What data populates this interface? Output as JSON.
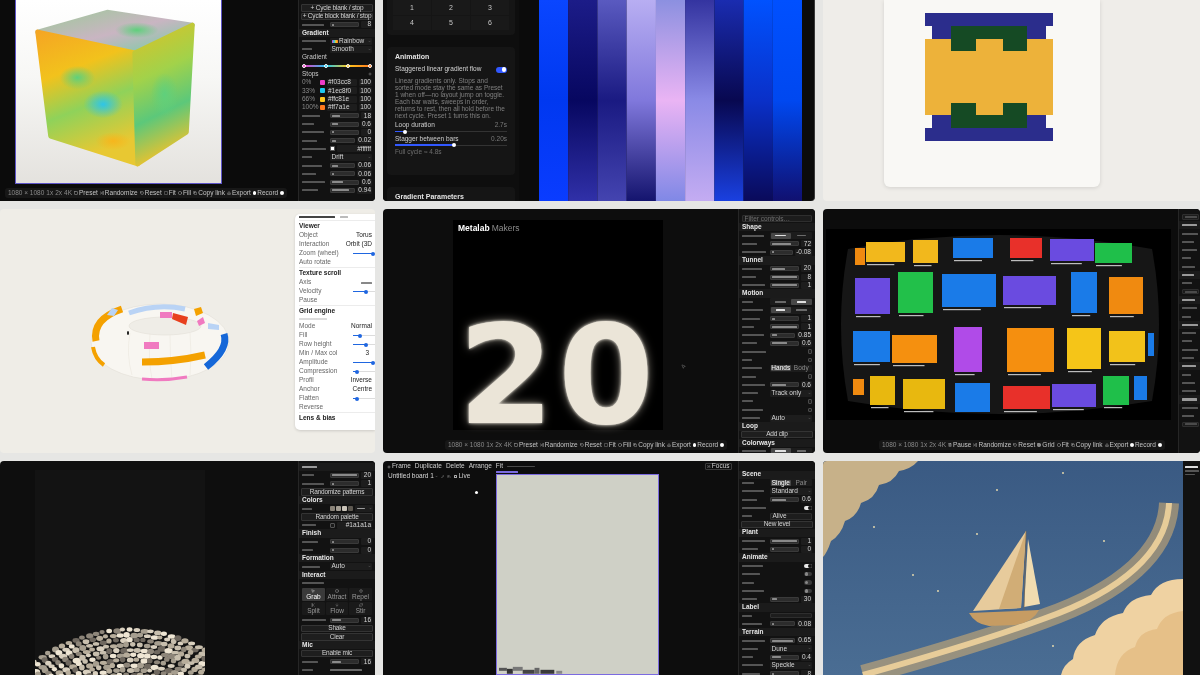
{
  "cube_editor": {
    "controls": [
      {
        "kind": "button",
        "label": "+ Cycle blank / stop"
      },
      {
        "kind": "button",
        "label": "+ Cycle block blank / stop"
      },
      {
        "kind": "slider",
        "level": 0.05,
        "value": "8"
      },
      {
        "kind": "header",
        "label": "Gradient"
      },
      {
        "kind": "palette",
        "value": "Rainbow"
      },
      {
        "kind": "select",
        "value": "Smooth"
      },
      {
        "kind": "gradient",
        "label": "Gradient"
      },
      {
        "kind": "subheader",
        "label": "Stops"
      },
      {
        "kind": "stop",
        "label": "0%",
        "color": "#f03cc8",
        "value": "#f03cc8",
        "amount": "100"
      },
      {
        "kind": "stop",
        "label": "33%",
        "color": "#1ec8f0",
        "value": "#1ec8f0",
        "amount": "100"
      },
      {
        "kind": "stop",
        "label": "66%",
        "color": "#ffc81e",
        "value": "#ffc81e",
        "amount": "100"
      },
      {
        "kind": "stop",
        "label": "100%",
        "color": "#ff7a1e",
        "value": "#ff7a1e",
        "amount": "100"
      },
      {
        "kind": "slider",
        "level": 0.3,
        "value": "18"
      },
      {
        "kind": "slider",
        "level": 0.25,
        "value": "0.6"
      },
      {
        "kind": "slider",
        "level": 0,
        "value": "0"
      },
      {
        "kind": "slider",
        "level": 0.18,
        "value": "0.02"
      },
      {
        "kind": "swatch",
        "color": "#ffffff",
        "value": "#ffffff"
      },
      {
        "kind": "select",
        "value": "Drift"
      },
      {
        "kind": "slider",
        "level": 0.3,
        "value": "0.06"
      },
      {
        "kind": "slider",
        "level": 0.04,
        "value": "0.06"
      },
      {
        "kind": "slider",
        "level": 0.45,
        "value": "0.6"
      },
      {
        "kind": "slider",
        "level": 0.78,
        "value": "0.94"
      }
    ],
    "toolbar": [
      {
        "kind": "size",
        "label": "1080 × 1080"
      },
      {
        "kind": "chip",
        "label": "1x"
      },
      {
        "kind": "chip",
        "label": "2x"
      },
      {
        "kind": "chip",
        "label": "4K"
      },
      {
        "kind": "preset",
        "label": "Preset"
      },
      {
        "kind": "randomize",
        "label": "Randomize"
      },
      {
        "kind": "reset",
        "label": "Reset"
      },
      {
        "kind": "fit",
        "label": "Fit"
      },
      {
        "kind": "fill",
        "label": "Fill"
      },
      {
        "kind": "copy",
        "label": "Copy link"
      },
      {
        "kind": "export",
        "label": "Export"
      },
      {
        "kind": "record",
        "label": "Record"
      },
      {
        "kind": "dot"
      }
    ]
  },
  "bars_editor": {
    "keypad": [
      "1",
      "2",
      "3",
      "4",
      "5",
      "6"
    ],
    "animation": {
      "title": "Animation",
      "toggle": {
        "label": "Staggered linear gradient flow",
        "on": true
      },
      "description": "Linear gradients only. Stops and sorted mode stay the same as Preset 1 when off—no layout jump on toggle. Each bar waits, sweeps in order, returns to rest, then all hold before the next cycle. Preset 1 turns this on.",
      "sliders": [
        {
          "label": "Loop duration",
          "value": "2.7s",
          "level": 0.09
        },
        {
          "label": "Stagger between bars",
          "value": "0.20s",
          "level": 0.53
        }
      ],
      "note": "Full cycle ≈ 4.8s"
    },
    "next_card": {
      "title": "Gradient Parameters"
    }
  },
  "torus_viewer": {
    "panel": {
      "controls": [
        {
          "kind": "header",
          "label": "Viewer"
        },
        {
          "kind": "select",
          "label": "Object",
          "value": "Torus"
        },
        {
          "kind": "select",
          "label": "Interaction",
          "value": "Orbit (3D"
        },
        {
          "kind": "slider",
          "label": "Zoom (wheel)",
          "level": 1
        },
        {
          "kind": "label",
          "label": "Auto rotate"
        },
        {
          "kind": "header",
          "label": "Texture scroll"
        },
        {
          "kind": "select",
          "label": "Axis"
        },
        {
          "kind": "slider",
          "label": "Velocity",
          "level": 0.6
        },
        {
          "kind": "label",
          "label": "Pause"
        },
        {
          "kind": "header",
          "label": "Grid engine"
        },
        {
          "kind": "note"
        },
        {
          "kind": "select",
          "label": "Mode",
          "value": "Normal"
        },
        {
          "kind": "slider",
          "label": "Fill",
          "level": 0.25
        },
        {
          "kind": "slider",
          "label": "Row height",
          "level": 0.6
        },
        {
          "kind": "text",
          "label": "Min / Max col",
          "value": "3"
        },
        {
          "kind": "slider",
          "label": "Amplitude",
          "level": 1
        },
        {
          "kind": "slider",
          "label": "Compression",
          "level": 0.1
        },
        {
          "kind": "select",
          "label": "Profil",
          "value": "Inverse"
        },
        {
          "kind": "select",
          "label": "Anchor",
          "value": "Centre"
        },
        {
          "kind": "slider",
          "label": "Flatten",
          "level": 0.1
        },
        {
          "kind": "label",
          "label": "Reverse"
        },
        {
          "kind": "header",
          "label": "Lens & bias"
        }
      ]
    }
  },
  "poster_editor": {
    "poster": {
      "title": "Metalab",
      "subtitle": "Makers",
      "numeral": "20"
    },
    "toolbar": [
      {
        "kind": "size",
        "label": "1080 × 1080"
      },
      {
        "kind": "chip",
        "label": "1x"
      },
      {
        "kind": "chip",
        "label": "2x"
      },
      {
        "kind": "chip",
        "label": "4K"
      },
      {
        "kind": "preset",
        "label": "Preset"
      },
      {
        "kind": "randomize",
        "label": "Randomize"
      },
      {
        "kind": "reset",
        "label": "Reset"
      },
      {
        "kind": "fit",
        "label": "Fit"
      },
      {
        "kind": "fill",
        "label": "Fill"
      },
      {
        "kind": "copy",
        "label": "Copy link"
      },
      {
        "kind": "export",
        "label": "Export"
      },
      {
        "kind": "record",
        "label": "Record"
      },
      {
        "kind": "dot"
      }
    ],
    "controls": [
      {
        "kind": "search",
        "placeholder": "Filter controls…"
      },
      {
        "kind": "header",
        "label": "Shape"
      },
      {
        "kind": "segmented",
        "options": [
          {
            "selected": true
          },
          {
            "selected": false
          }
        ]
      },
      {
        "kind": "slider",
        "level": 0.75,
        "value": "72"
      },
      {
        "kind": "slider",
        "level": 0.12,
        "value": "-0.08"
      },
      {
        "kind": "header",
        "label": "Tunnel"
      },
      {
        "kind": "slider",
        "level": 0.5,
        "value": "20"
      },
      {
        "kind": "slider",
        "level": 1,
        "value": "8"
      },
      {
        "kind": "slider",
        "level": 1,
        "value": "1"
      },
      {
        "kind": "header",
        "label": "Motion"
      },
      {
        "kind": "segmented",
        "options": [
          {
            "selected": false
          },
          {
            "selected": true
          }
        ]
      },
      {
        "kind": "segmented",
        "options": [
          {
            "selected": true
          },
          {
            "selected": false
          }
        ]
      },
      {
        "kind": "slider",
        "level": 0.12,
        "value": "1"
      },
      {
        "kind": "slider",
        "level": 1,
        "value": "1"
      },
      {
        "kind": "slider",
        "level": 0.25,
        "value": "0.85"
      },
      {
        "kind": "slider",
        "level": 0.6,
        "value": "0.6"
      },
      {
        "kind": "check",
        "checked": false
      },
      {
        "kind": "check",
        "checked": false
      },
      {
        "kind": "segmented",
        "options": [
          {
            "label": "Hands",
            "selected": true
          },
          {
            "label": "Body",
            "selected": false
          }
        ]
      },
      {
        "kind": "check",
        "checked": false
      },
      {
        "kind": "slider",
        "level": 0.55,
        "value": "0.6"
      },
      {
        "kind": "select",
        "value": "Track only"
      },
      {
        "kind": "check",
        "checked": false
      },
      {
        "kind": "check",
        "checked": false
      },
      {
        "kind": "select",
        "value": "Auto"
      },
      {
        "kind": "header",
        "label": "Loop"
      },
      {
        "kind": "button",
        "label": "Add clip"
      },
      {
        "kind": "header",
        "label": "Colorways"
      },
      {
        "kind": "segmented",
        "options": [
          {
            "selected": true
          },
          {
            "selected": false
          }
        ]
      }
    ]
  },
  "gallery_editor": {
    "toolbar": [
      {
        "kind": "size",
        "label": "1080 × 1080"
      },
      {
        "kind": "chip",
        "label": "1x"
      },
      {
        "kind": "chip",
        "label": "2x"
      },
      {
        "kind": "chip",
        "label": "4K"
      },
      {
        "kind": "pause",
        "label": "Pause"
      },
      {
        "kind": "randomize",
        "label": "Randomize"
      },
      {
        "kind": "reset",
        "label": "Reset"
      },
      {
        "kind": "grid",
        "label": "Grid"
      },
      {
        "kind": "fill",
        "label": "Fit"
      },
      {
        "kind": "copy",
        "label": "Copy link"
      },
      {
        "kind": "export",
        "label": "Export"
      },
      {
        "kind": "record",
        "label": "Record"
      },
      {
        "kind": "dot"
      }
    ],
    "controls": [
      {
        "kind": "search"
      },
      {
        "kind": "header"
      },
      {
        "kind": "label"
      },
      {
        "kind": "label"
      },
      {
        "kind": "label"
      },
      {
        "kind": "label"
      },
      {
        "kind": "label"
      },
      {
        "kind": "header"
      },
      {
        "kind": "label"
      },
      {
        "kind": "search"
      },
      {
        "kind": "header"
      },
      {
        "kind": "label"
      },
      {
        "kind": "label"
      },
      {
        "kind": "header"
      },
      {
        "kind": "label"
      },
      {
        "kind": "label"
      },
      {
        "kind": "label"
      },
      {
        "kind": "label"
      },
      {
        "kind": "header"
      },
      {
        "kind": "label"
      },
      {
        "kind": "label"
      },
      {
        "kind": "label"
      },
      {
        "kind": "header"
      },
      {
        "kind": "label"
      },
      {
        "kind": "label"
      },
      {
        "kind": "search"
      }
    ]
  },
  "pebbles_editor": {
    "controls": [
      {
        "kind": "header"
      },
      {
        "kind": "slider",
        "level": 1,
        "value": "20"
      },
      {
        "kind": "slider",
        "level": 0,
        "value": "1"
      },
      {
        "kind": "button",
        "label": "Randomize patterns"
      },
      {
        "kind": "header",
        "label": "Colors"
      },
      {
        "kind": "swatches",
        "swatches": [
          {
            "color": "#8a8378"
          },
          {
            "color": "#a39d92"
          },
          {
            "color": "#c9c3b8"
          },
          {
            "color": "#5d5850"
          }
        ]
      },
      {
        "kind": "button",
        "label": "Random palette"
      },
      {
        "kind": "swatch",
        "color": "#1a1a1a",
        "value": "#1a1a1a"
      },
      {
        "kind": "header",
        "label": "Finish"
      },
      {
        "kind": "slider",
        "level": 0,
        "value": "0"
      },
      {
        "kind": "slider",
        "level": 0,
        "value": "0"
      },
      {
        "kind": "header",
        "label": "Formation"
      },
      {
        "kind": "select",
        "value": "Auto"
      },
      {
        "kind": "header",
        "label": "Interact"
      },
      {
        "kind": "label"
      },
      {
        "kind": "tools",
        "options": [
          {
            "label": "Grab",
            "selected": true
          },
          {
            "label": "Attract",
            "selected": false
          },
          {
            "label": "Repel",
            "selected": false
          },
          {
            "label": "Split",
            "selected": false
          },
          {
            "label": "Flow",
            "selected": false
          },
          {
            "label": "Stir",
            "selected": false
          }
        ]
      },
      {
        "kind": "slider",
        "level": 0.35,
        "value": "16"
      },
      {
        "kind": "button",
        "label": "Shake"
      },
      {
        "kind": "button",
        "label": "Clear"
      },
      {
        "kind": "header",
        "label": "Mic"
      },
      {
        "kind": "button",
        "label": "Enable mic"
      },
      {
        "kind": "slider",
        "level": 0.35,
        "value": "16"
      },
      {
        "kind": "text"
      }
    ]
  },
  "board_editor": {
    "menu": [
      {
        "kind": "add",
        "label": "Frame"
      },
      {
        "kind": "action",
        "label": "Duplicate"
      },
      {
        "kind": "action",
        "label": "Delete"
      },
      {
        "kind": "action",
        "label": "Arrange"
      },
      {
        "kind": "action",
        "label": "Fit"
      },
      {
        "kind": "status"
      }
    ],
    "focus": "Focus",
    "board": {
      "title": "Untitled board 1",
      "live": {
        "label": "Live",
        "checked": false
      }
    },
    "controls": [
      {
        "kind": "header",
        "label": "Scene"
      },
      {
        "kind": "segmented",
        "options": [
          {
            "label": "Single",
            "selected": true
          },
          {
            "label": "Pair",
            "selected": false
          }
        ]
      },
      {
        "kind": "select",
        "value": "Standard"
      },
      {
        "kind": "slider",
        "level": 0.55,
        "value": "0.6"
      },
      {
        "kind": "toggle",
        "on": true
      },
      {
        "kind": "field",
        "value": "Alive"
      },
      {
        "kind": "button",
        "label": "New level"
      },
      {
        "kind": "header",
        "label": "Plant"
      },
      {
        "kind": "slider",
        "level": 1,
        "value": "1"
      },
      {
        "kind": "slider",
        "level": 0,
        "value": "0"
      },
      {
        "kind": "header",
        "label": "Animate"
      },
      {
        "kind": "toggle",
        "on": true
      },
      {
        "kind": "toggle",
        "on": false
      },
      {
        "kind": "toggle",
        "on": false
      },
      {
        "kind": "toggle",
        "on": false
      },
      {
        "kind": "slider",
        "level": 0.2,
        "value": "30"
      },
      {
        "kind": "header",
        "label": "Label"
      },
      {
        "kind": "empty-field"
      },
      {
        "kind": "slider",
        "level": 0.02,
        "value": "0.08"
      },
      {
        "kind": "header",
        "label": "Terrain"
      },
      {
        "kind": "slider",
        "level": 1,
        "value": "0.65"
      },
      {
        "kind": "select",
        "value": "Dune"
      },
      {
        "kind": "slider",
        "level": 0.35,
        "value": "0.4"
      },
      {
        "kind": "select",
        "value": "Speckle"
      },
      {
        "kind": "slider",
        "level": 0,
        "value": "8"
      }
    ]
  }
}
